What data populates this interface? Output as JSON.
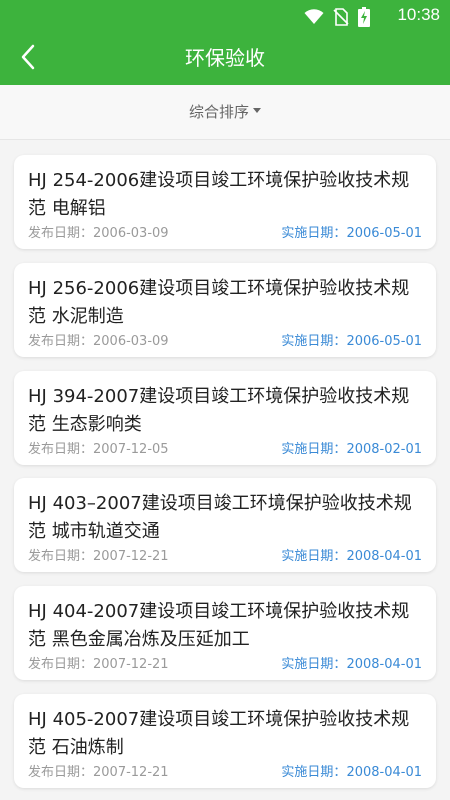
{
  "status_bar": {
    "time": "10:38"
  },
  "header": {
    "title": "环保验收"
  },
  "sort": {
    "label": "综合排序"
  },
  "list": {
    "items": [
      {
        "title": "HJ 254-2006建设项目竣工环境保护验收技术规范 电解铝",
        "published_label": "发布日期：",
        "published": "2006-03-09",
        "effective_label": "实施日期：",
        "effective": "2006-05-01"
      },
      {
        "title": "HJ 256-2006建设项目竣工环境保护验收技术规范 水泥制造",
        "published_label": "发布日期：",
        "published": "2006-03-09",
        "effective_label": "实施日期：",
        "effective": "2006-05-01"
      },
      {
        "title": "HJ 394-2007建设项目竣工环境保护验收技术规范 生态影响类",
        "published_label": "发布日期：",
        "published": "2007-12-05",
        "effective_label": "实施日期：",
        "effective": "2008-02-01"
      },
      {
        "title": "HJ 403–2007建设项目竣工环境保护验收技术规范 城市轨道交通",
        "published_label": "发布日期：",
        "published": "2007-12-21",
        "effective_label": "实施日期：",
        "effective": "2008-04-01"
      },
      {
        "title": "HJ 404-2007建设项目竣工环境保护验收技术规范 黑色金属冶炼及压延加工",
        "published_label": "发布日期：",
        "published": "2007-12-21",
        "effective_label": "实施日期：",
        "effective": "2008-04-01"
      },
      {
        "title": "HJ 405-2007建设项目竣工环境保护验收技术规范 石油炼制",
        "published_label": "发布日期：",
        "published": "2007-12-21",
        "effective_label": "实施日期：",
        "effective": "2008-04-01"
      }
    ]
  },
  "colors": {
    "header_bg": "#3db33d",
    "effective_date": "#3a8ad6"
  }
}
